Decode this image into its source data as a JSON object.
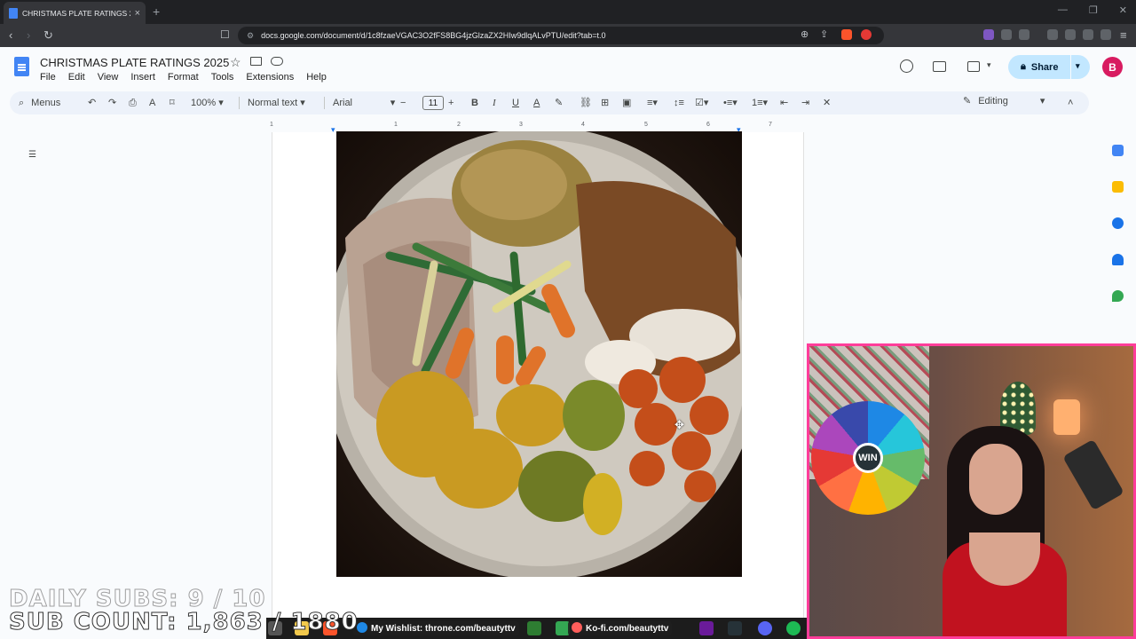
{
  "browser": {
    "tab_title": "CHRISTMAS PLATE RATINGS 20...",
    "tab_close": "×",
    "new_tab": "+",
    "url": "docs.google.com/document/d/1c8fzaeVGAC3O2fFS8BG4jzGlzaZX2HIw9dlqALvPTU/edit?tab=t.0",
    "window_controls": [
      "—",
      "❐",
      "✕"
    ]
  },
  "docs": {
    "title": "CHRISTMAS PLATE RATINGS 2025",
    "menu": [
      "File",
      "Edit",
      "View",
      "Insert",
      "Format",
      "Tools",
      "Extensions",
      "Help"
    ],
    "share_label": "Share",
    "avatar_letter": "B",
    "toolbar": {
      "menus_label": "Menus",
      "zoom": "100%",
      "style": "Normal text",
      "font": "Arial",
      "font_size": "11",
      "mode": "Editing"
    },
    "ruler_marks": [
      "1",
      "1",
      "2",
      "3",
      "4",
      "5",
      "6",
      "7"
    ]
  },
  "overlay": {
    "daily_subs": "DAILY SUBS: 9 / 10",
    "sub_count": "SUB COUNT: 1,863 / 1880",
    "wishlist": "My Wishlist: throne.com/beautyttv",
    "kofi": "Ko-fi.com/beautyttv",
    "wheel_center": "WIN"
  },
  "colors": {
    "accent_blue": "#4285f4",
    "share_bg": "#c2e7ff",
    "avatar_bg": "#d81b60",
    "webcam_border": "#ff3d9a"
  }
}
